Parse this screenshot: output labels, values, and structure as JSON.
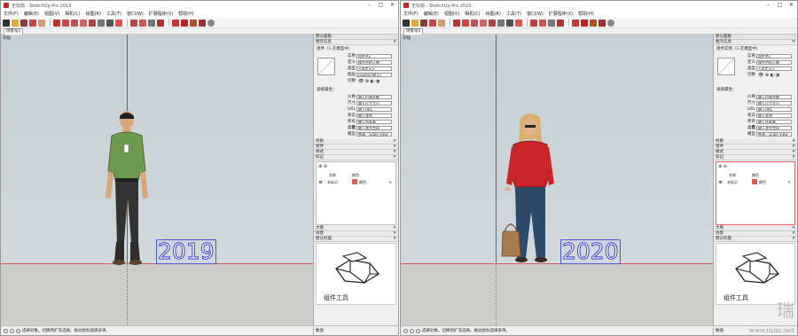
{
  "left": {
    "title": "无标题 - SketchUp Pro 2019",
    "menu": [
      "文件(F)",
      "编辑(E)",
      "视图(V)",
      "相机(C)",
      "绘图(R)",
      "工具(T)",
      "窗口(W)",
      "扩展程序(X)",
      "帮助(H)"
    ],
    "scene_tab": "场景号1",
    "viewport_label": "等轴",
    "year": "2019",
    "status": "选择对象。切换到扩充选择。拖动鼠标选择多项。",
    "measure_label": "数值",
    "tray_title": "默认面板",
    "entity_info_title": "图元信息",
    "entity_title": "组件（1 在模型中）",
    "fields": [
      {
        "label": "实例",
        "value": "组件#1"
      },
      {
        "label": "定义",
        "value": "模型中的人物"
      },
      {
        "label": "类型",
        "value": "<未定义>"
      },
      {
        "label": "图层",
        "value": "Layer0 (默认)"
      }
    ],
    "toggles_label": "切换",
    "advanced_label": "高级属性：",
    "adv_fields": [
      {
        "label": "价格",
        "value": "输入价格金额"
      },
      {
        "label": "尺寸",
        "value": "输入尺寸大小"
      },
      {
        "label": "URL",
        "value": "输入URL"
      },
      {
        "label": "状态",
        "value": "输入状态"
      },
      {
        "label": "所有者",
        "value": "输入所有者"
      },
      {
        "label": "类型",
        "value": "输入类型字段"
      }
    ],
    "ifc_label": "模型",
    "ifc_value": "普通 - Scale View",
    "sections": [
      "材质",
      "组件",
      "样式",
      "标记"
    ],
    "tag_headers": [
      "名称",
      "颜色"
    ],
    "tag_row": {
      "name": "未标记",
      "color": "#e05a4e",
      "color_label": "颜色"
    },
    "sections_bottom": [
      "大纲",
      "场景",
      "默认托盘"
    ],
    "preview_caption": "组件工具"
  },
  "right": {
    "title": "无标题 - SketchUp Pro 2020",
    "menu": [
      "文件(F)",
      "编辑(E)",
      "视图(V)",
      "相机(C)",
      "绘图(R)",
      "工具(T)",
      "窗口(W)",
      "扩展程序(X)",
      "帮助(H)"
    ],
    "scene_tab": "场景号1",
    "viewport_label": "等轴",
    "year": "2020",
    "status": "选择对象。切换到扩充选择。拖动鼠标选择多项。",
    "measure_label": "数值",
    "tray_title": "默认面板",
    "entity_info_title": "图元信息",
    "entity_title": "组件实例（1 在模型中）",
    "fields": [
      {
        "label": "实例",
        "value": "组件#1"
      },
      {
        "label": "定义",
        "value": "模型中的人物"
      },
      {
        "label": "类型",
        "value": "<未定义>"
      }
    ],
    "toggles_label": "切换",
    "advanced_label": "高级属性：",
    "adv_fields": [
      {
        "label": "价格",
        "value": "输入价格金额"
      },
      {
        "label": "尺寸",
        "value": "输入尺寸大小"
      },
      {
        "label": "URL",
        "value": "输入URL"
      },
      {
        "label": "状态",
        "value": "输入状态"
      },
      {
        "label": "所有者",
        "value": "输入所有者"
      },
      {
        "label": "类型",
        "value": "输入类型字段"
      }
    ],
    "ifc_label": "模型",
    "ifc_value": "普通 - Scale View",
    "sections": [
      "材质",
      "组件",
      "样式",
      "标记"
    ],
    "tag_headers": [
      "名称",
      "颜色"
    ],
    "tag_row": {
      "name": "未标记",
      "color": "#e05a4e",
      "color_label": "颜色"
    },
    "sections_bottom": [
      "大纲",
      "场景",
      "默认托盘"
    ],
    "preview_caption": "组件工具"
  },
  "watermark": {
    "logo": "瑞",
    "url": "www.ruixc.net"
  }
}
